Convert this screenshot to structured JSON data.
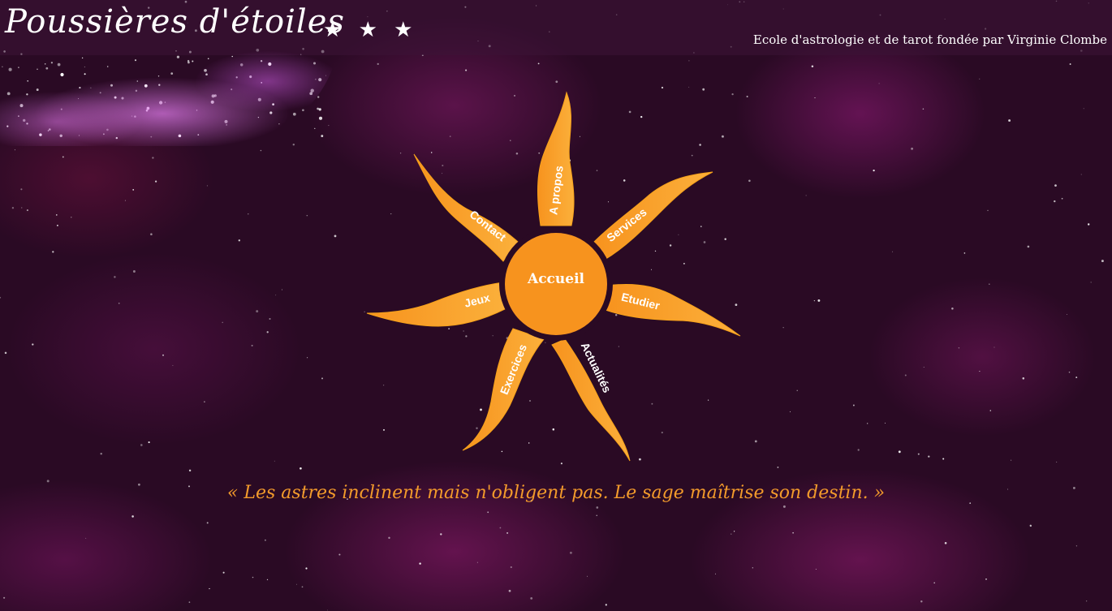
{
  "header": {
    "site_title": "Poussières d'étoiles",
    "title_stars": "★ ★ ★",
    "tagline": "Ecole d'astrologie et de tarot fondée par Virginie Clombe"
  },
  "menu": {
    "center_label": "Accueil",
    "rays": [
      {
        "id": "apropos",
        "label": "A propos"
      },
      {
        "id": "services",
        "label": "Services"
      },
      {
        "id": "etudier",
        "label": "Etudier"
      },
      {
        "id": "actualites",
        "label": "Actualités"
      },
      {
        "id": "exercices",
        "label": "Exercices"
      },
      {
        "id": "jeux",
        "label": "Jeux"
      },
      {
        "id": "contact",
        "label": "Contact"
      }
    ]
  },
  "quote": "« Les astres inclinent mais n'obligent pas. Le sage maîtrise son destin. »",
  "colors": {
    "background": "#2a0a24",
    "sun_orange": "#f7931e",
    "ray_yellow": "#fbb03b",
    "quote": "#f29a2b",
    "text": "#ffffff"
  }
}
